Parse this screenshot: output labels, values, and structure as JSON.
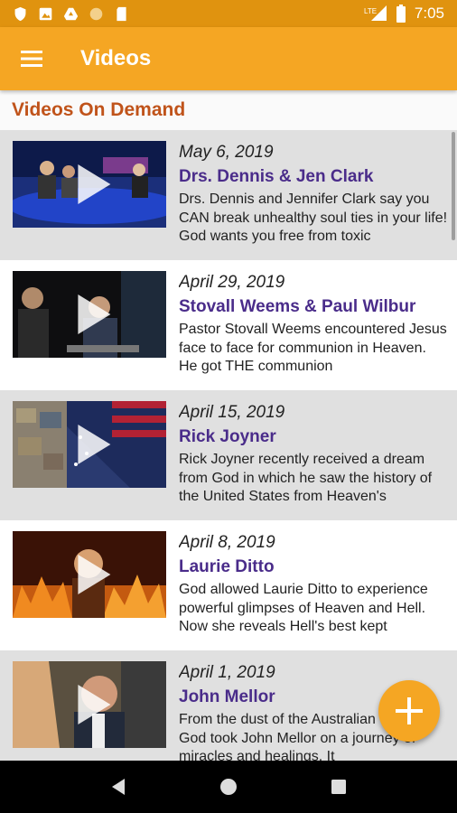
{
  "status_bar": {
    "time": "7:05",
    "network_label": "LTE",
    "left_icons": [
      "shield-icon",
      "photo-icon",
      "drive-icon",
      "circle-icon",
      "sd-card-icon"
    ],
    "right_icons": [
      "signal-icon",
      "battery-icon"
    ]
  },
  "app_bar": {
    "title": "Videos",
    "menu_icon": "hamburger-menu-icon",
    "color": "#f5a623"
  },
  "section": {
    "title": "Videos On Demand",
    "color": "#c0531a"
  },
  "videos": [
    {
      "date": "May 6, 2019",
      "name": "Drs. Dennis & Jen Clark",
      "description": "Drs. Dennis and Jennifer Clark say you CAN break unhealthy soul ties in your life! God wants you free from toxic"
    },
    {
      "date": "April 29, 2019",
      "name": "Stovall Weems & Paul Wilbur",
      "description": "Pastor Stovall Weems encountered Jesus face to face for communion in Heaven. He got THE communion"
    },
    {
      "date": "April 15, 2019",
      "name": "Rick Joyner",
      "description": "Rick Joyner recently received a dream from God in which he saw the history of the United States from Heaven's"
    },
    {
      "date": "April 8, 2019",
      "name": "Laurie Ditto",
      "description": "God allowed Laurie Ditto to experience powerful glimpses of Heaven and Hell. Now she reveals Hell's best kept"
    },
    {
      "date": "April 1, 2019",
      "name": "John Mellor",
      "description": "From the dust of the Australian Outback, God took John Mellor on a journey of miracles and healings. It"
    }
  ],
  "fab": {
    "icon": "plus-icon"
  },
  "nav_bar": {
    "icons": [
      "back-icon",
      "home-icon",
      "recents-icon"
    ]
  },
  "colors": {
    "status_bar": "#e0930f",
    "accent": "#f5a623",
    "name_text": "#4a2c8a",
    "row_shaded": "#e0e0e0"
  }
}
